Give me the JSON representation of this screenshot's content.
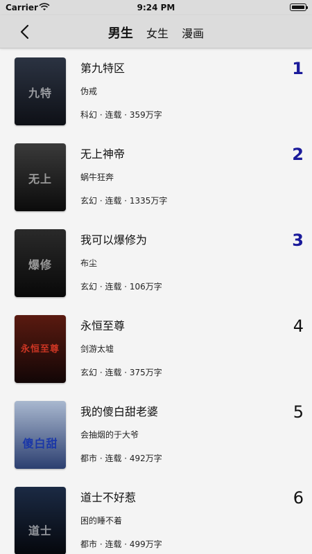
{
  "status_bar": {
    "carrier": "Carrier",
    "time": "9:24 PM"
  },
  "nav": {
    "back_icon": "chevron-left-icon",
    "tabs": [
      {
        "label": "男生",
        "active": true
      },
      {
        "label": "女生",
        "active": false
      },
      {
        "label": "漫画",
        "active": false
      }
    ]
  },
  "books": [
    {
      "title": "第九特区",
      "author": "伪戒",
      "meta": "科幻 · 连载 · 359万字",
      "rank": "1",
      "cover_text": "九特",
      "cover_colors": [
        "#2b3342",
        "#0e1016"
      ]
    },
    {
      "title": "无上神帝",
      "author": "蜗牛狂奔",
      "meta": "玄幻 · 连载 · 1335万字",
      "rank": "2",
      "cover_text": "无上",
      "cover_colors": [
        "#3a3a3a",
        "#0b0b0b"
      ]
    },
    {
      "title": "我可以爆修为",
      "author": "布尘",
      "meta": "玄幻 · 连载 · 106万字",
      "rank": "3",
      "cover_text": "爆修",
      "cover_colors": [
        "#2a2a2a",
        "#080808"
      ]
    },
    {
      "title": "永恒至尊",
      "author": "剑游太墟",
      "meta": "玄幻 · 连载 · 375万字",
      "rank": "4",
      "cover_text": "永恒至尊",
      "cover_colors": [
        "#5a1a10",
        "#120606"
      ]
    },
    {
      "title": "我的傻白甜老婆",
      "author": "会抽烟的于大爷",
      "meta": "都市 · 连载 · 492万字",
      "rank": "5",
      "cover_text": "傻白甜",
      "cover_colors": [
        "#a9b8cf",
        "#2c3f70"
      ]
    },
    {
      "title": "道士不好惹",
      "author": "困的睡不着",
      "meta": "都市 · 连载 · 499万字",
      "rank": "6",
      "cover_text": "道士",
      "cover_colors": [
        "#1b2a44",
        "#05070c"
      ]
    }
  ]
}
